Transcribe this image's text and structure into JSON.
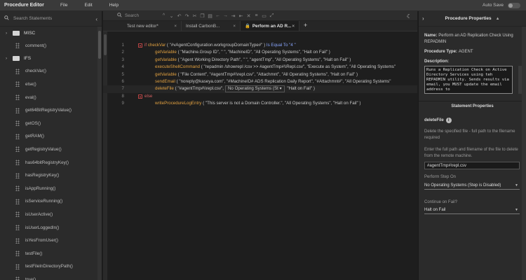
{
  "app": {
    "title": "Procedure Editor",
    "autosave_label": "Auto Save"
  },
  "menu": {
    "file": "File",
    "edit": "Edit",
    "help": "Help"
  },
  "sidebar": {
    "search_placeholder": "Search Statements",
    "folders": [
      {
        "name": "MISC",
        "items": [
          "comment()"
        ]
      },
      {
        "name": "IFS",
        "items": [
          "checkVar()",
          "else()",
          "eval()",
          "get64BitRegistryValue()",
          "getOS()",
          "getRAM()",
          "getRegistryValue()",
          "has64bitRegistryKey()",
          "hasRegistryKey()",
          "isAppRunning()",
          "isServiceRunning()",
          "isUserActive()",
          "isUserLoggedIn()",
          "isYesFromUser()",
          "testFile()",
          "testFileInDirectoryPath()",
          "true()"
        ]
      }
    ]
  },
  "editor": {
    "search_placeholder": "Search",
    "tabs": [
      {
        "label": "Test new editor*",
        "active": false
      },
      {
        "label": "Install CarbonB...",
        "active": false
      },
      {
        "label": "Perform an AD R...",
        "active": true
      }
    ],
    "lines": [
      {
        "n": "1",
        "kw": "if",
        "fn": "checkVar",
        "args": "( \"#vAgentConfiguration.workgroupDomainType#\" )",
        "op": "Is Equal To \"4 \""
      },
      {
        "n": "2",
        "fn": "getVariable",
        "args": "( \"Machine.Group ID\",  \"  \",  \"MachineID\",  \"All Operating Systems\",  \"Halt on Fail\" )"
      },
      {
        "n": "3",
        "fn": "getVariable",
        "args": "( \"Agent Working Directory Path\",  \"  \",  \"agentTmp\",  \"All Operating Systems\",  \"Halt on Fail\" )"
      },
      {
        "n": "4",
        "fn": "executeShellCommand",
        "args": "( \"repadmin /showrepl /csv >> #agentTmp#\\\\Repl.csv\",  \"Execute as System\",  \"All Operating Systems\""
      },
      {
        "n": "5",
        "fn": "getVariable",
        "args": "( \"File Content\",  \"#agentTmp#\\\\repl.csv\",  \"Attachmnt\",  \"All Operating Systems\",  \"Halt on Fail\" )"
      },
      {
        "n": "6",
        "fn": "sendEmail",
        "args": "( \"noreply@kaseya.com\",  \"#MachineID# ADS Replication Daily Report\",  \"#Attachmnt#\",  \"All Operating Systems\""
      },
      {
        "n": "7",
        "fn": "deleteFile",
        "args": "( \"#agentTmp#\\\\repl.csv\",",
        "select": "No Operating Systems (St",
        "tail": " \"Halt on Fail\" )"
      },
      {
        "n": "8",
        "kw": "else"
      },
      {
        "n": "9",
        "fn": "writeProcedureLogEntry",
        "args": "( \"This server is not a Domain Controller.\",  \"All Operating Systems\",  \"Halt on Fail\" )"
      }
    ]
  },
  "properties": {
    "header": "Procedure Properties",
    "name_label": "Name:",
    "name_value": "Perform an AD Replication Check Using REPADMIN",
    "type_label": "Procedure Type:",
    "type_value": "AGENT",
    "desc_label": "Description:",
    "desc_value": "Runs a Replication Check on Active Directory Services using teh REPADMIN utility.  Sends results via email, you MUST update the email address to"
  },
  "statement": {
    "header": "Statement Properties",
    "name": "deleteFile",
    "info": "i",
    "desc": "Delete the specified file - full path to the filename required",
    "path_help": "Enter the full path and filename of the file to delete from the remote machine.",
    "path_value": "#agentTmp#\\repl.csv",
    "step_label": "Perform Step On",
    "step_value": "No Operating Systems (Step is Disabled)",
    "fail_label": "Continue on Fail?",
    "fail_value": "Halt on Fail"
  }
}
